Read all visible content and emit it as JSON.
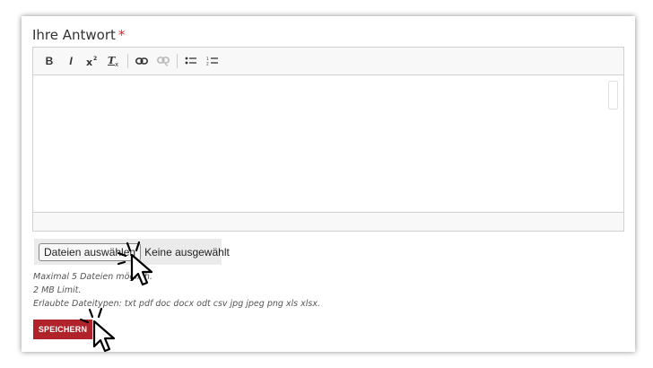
{
  "field": {
    "label": "Ihre Antwort",
    "required_mark": "*"
  },
  "toolbar": {
    "bold": "B",
    "italic": "I",
    "superscript": "x²",
    "remove_format": "Tx",
    "link_icon": "link-icon",
    "unlink_icon": "unlink-icon",
    "bulleted_list_icon": "bulleted-list-icon",
    "numbered_list_icon": "numbered-list-icon"
  },
  "file_upload": {
    "button_label": "Dateien auswählen",
    "status": "Keine ausgewählt"
  },
  "hints": {
    "max_files": "Maximal 5 Dateien möglich.",
    "size_limit": "2 MB Limit.",
    "allowed_types": "Erlaubte Dateitypen: txt pdf doc docx odt csv jpg jpeg png xls xlsx."
  },
  "actions": {
    "save_label": "SPEICHERN"
  },
  "colors": {
    "required": "#e4222c",
    "save_button": "#b0232a"
  }
}
